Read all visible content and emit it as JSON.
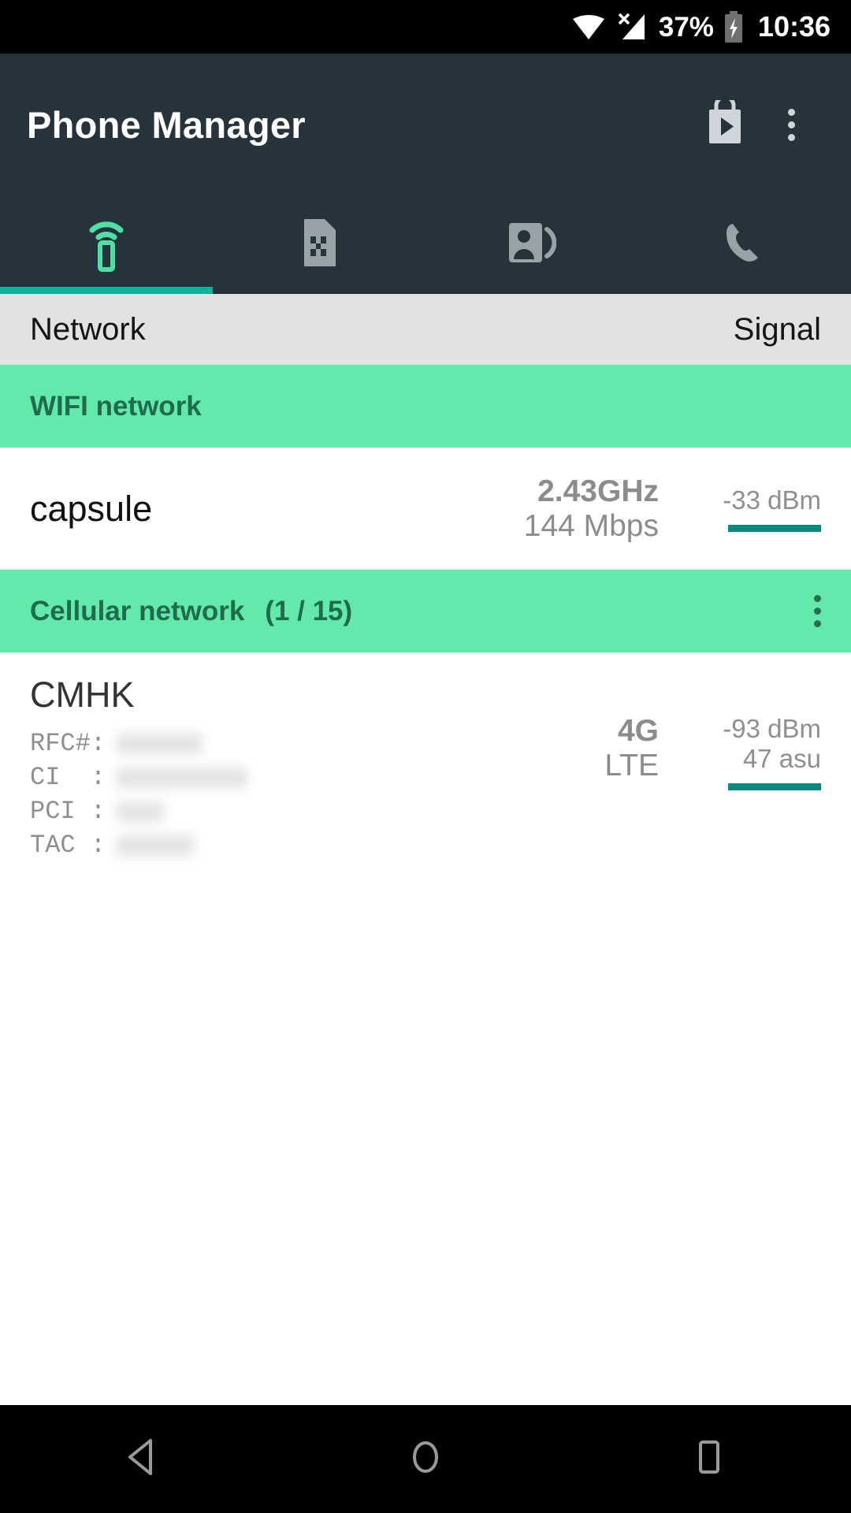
{
  "status_bar": {
    "wifi_icon": "wifi-icon",
    "cellular_icon": "cellular-signal-no-service-icon",
    "battery_percent": "37%",
    "battery_icon": "battery-charging-icon",
    "time": "10:36"
  },
  "app_bar": {
    "title": "Phone Manager",
    "play_store_icon": "play-store-bag-icon",
    "overflow_icon": "overflow-menu-icon"
  },
  "tabs": [
    {
      "icon": "phone-wifi-signal-icon",
      "active": true
    },
    {
      "icon": "sim-card-icon",
      "active": false
    },
    {
      "icon": "contacts-icon",
      "active": false
    },
    {
      "icon": "phone-call-icon",
      "active": false
    }
  ],
  "column_header": {
    "left": "Network",
    "right": "Signal"
  },
  "sections": {
    "wifi": {
      "title": "WIFI network",
      "row": {
        "name": "capsule",
        "frequency": "2.43GHz",
        "speed": "144 Mbps",
        "dbm": "-33 dBm"
      }
    },
    "cellular": {
      "title": "Cellular network",
      "count": "(1 / 15)",
      "overflow_icon": "overflow-menu-icon",
      "row": {
        "operator": "CMHK",
        "fields": [
          {
            "label": "RFC#:",
            "value_redacted": true,
            "value_width": 108
          },
          {
            "label": "CI  :",
            "value_redacted": true,
            "value_width": 166
          },
          {
            "label": "PCI :",
            "value_redacted": true,
            "value_width": 60
          },
          {
            "label": "TAC :",
            "value_redacted": true,
            "value_width": 98
          }
        ],
        "generation": "4G",
        "technology": "LTE",
        "dbm": "-93 dBm",
        "asu": "47 asu"
      }
    }
  },
  "nav_bar": {
    "back_icon": "back-triangle-icon",
    "home_icon": "home-circle-icon",
    "recents_icon": "recents-square-icon"
  },
  "colors": {
    "appbar": "#27333a",
    "section_band": "#63eaab",
    "section_text": "#1f6b4d",
    "accent_teal": "#00b39a",
    "signal_bar": "#078a7e",
    "column_header_bg": "#e2e2e2"
  }
}
